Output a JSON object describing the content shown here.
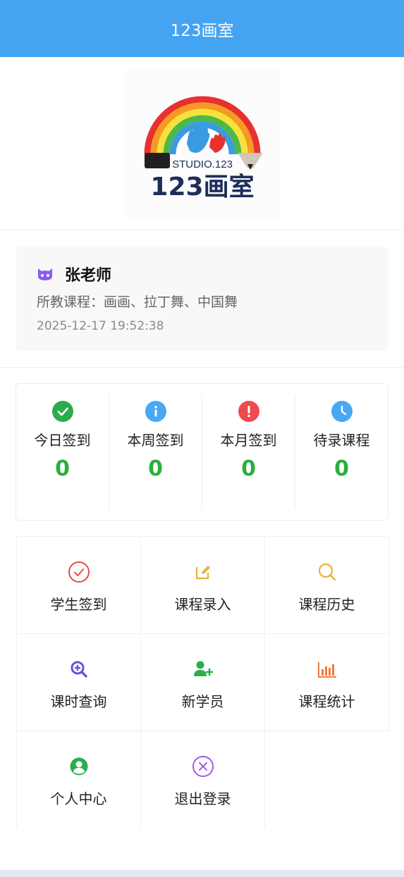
{
  "header": {
    "title": "123画室"
  },
  "logo": {
    "studio_text": "STUDIO.123",
    "name_text": "123画室"
  },
  "teacher": {
    "name": "张老师",
    "courses": "所教课程：画画、拉丁舞、中国舞",
    "datetime": "2025-12-17 19:52:38",
    "icon": "cat-face-icon"
  },
  "stats": [
    {
      "label": "今日签到",
      "value": "0",
      "icon": "check-circle-icon",
      "color": "#2cad4d"
    },
    {
      "label": "本周签到",
      "value": "0",
      "icon": "info-circle-icon",
      "color": "#48a8f4"
    },
    {
      "label": "本月签到",
      "value": "0",
      "icon": "exclamation-circle-icon",
      "color": "#f0494f"
    },
    {
      "label": "待录课程",
      "value": "0",
      "icon": "clock-circle-icon",
      "color": "#48a8f4"
    }
  ],
  "menu": [
    {
      "label": "学生签到",
      "icon": "check-outline-icon",
      "color": "#e84a4f"
    },
    {
      "label": "课程录入",
      "icon": "edit-icon",
      "color": "#e8b23c"
    },
    {
      "label": "课程历史",
      "icon": "search-icon",
      "color": "#e8b23c"
    },
    {
      "label": "课时查询",
      "icon": "zoom-in-icon",
      "color": "#6b4fe0"
    },
    {
      "label": "新学员",
      "icon": "add-user-icon",
      "color": "#2cad4d"
    },
    {
      "label": "课程统计",
      "icon": "bar-chart-icon",
      "color": "#f07a3a"
    },
    {
      "label": "个人中心",
      "icon": "user-circle-icon",
      "color": "#2cad4d"
    },
    {
      "label": "退出登录",
      "icon": "close-circle-icon",
      "color": "#a25af0"
    }
  ],
  "colors": {
    "header": "#44a4f2",
    "stat_value": "#2cad3c"
  }
}
